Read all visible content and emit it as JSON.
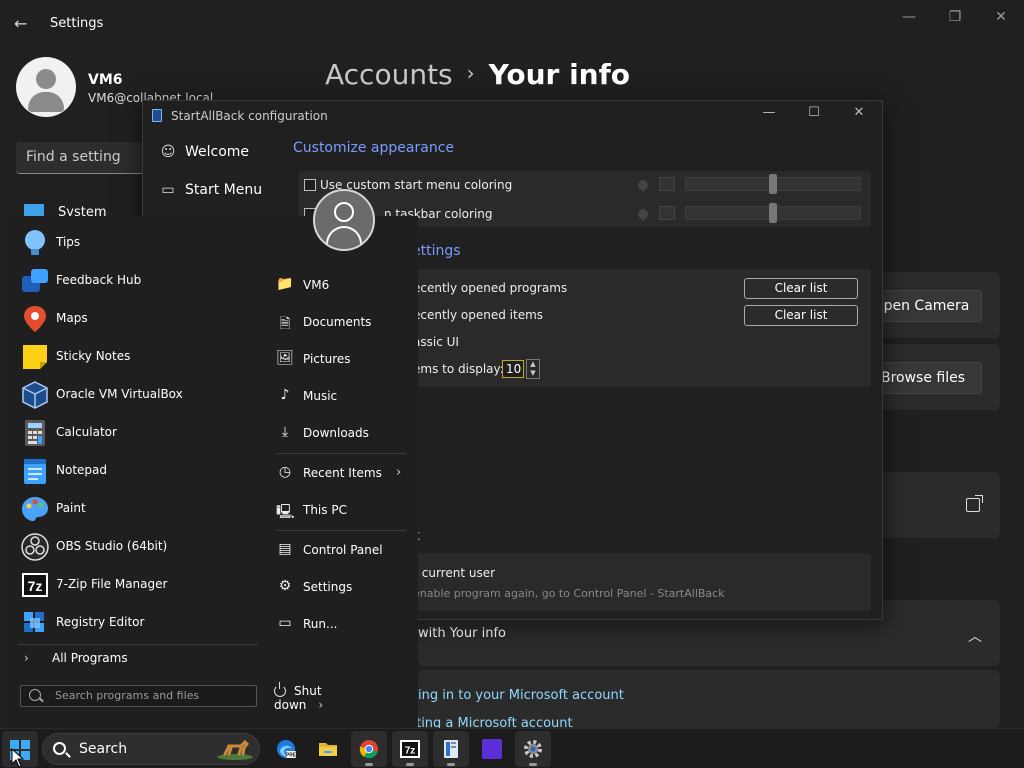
{
  "settings": {
    "title": "Settings",
    "back_icon": "←",
    "user": {
      "name": "VM6",
      "email": "VM6@collabnet.local"
    },
    "find_placeholder": "Find a setting",
    "nav_system": "System",
    "breadcrumb": {
      "parent": "Accounts",
      "separator": "›",
      "current": "Your info"
    },
    "open_camera": "Open Camera",
    "browse_files": "Browse files",
    "related_header": "with Your info",
    "link1": "ing in to your Microsoft account",
    "link2": "Creating a Microsoft account",
    "window_controls": {
      "minimize": "—",
      "maximize": "❐",
      "close": "✕"
    }
  },
  "sab": {
    "title": "StartAllBack configuration",
    "window_controls": {
      "minimize": "—",
      "maximize": "☐",
      "close": "✕"
    },
    "nav": [
      {
        "label": "Welcome",
        "icon": "☺"
      },
      {
        "label": "Start Menu",
        "icon": "▭"
      }
    ],
    "customize_heading": "Customize appearance",
    "opt_start_coloring": "Use custom start menu coloring",
    "opt_taskbar_coloring": "n taskbar coloring",
    "settings_heading": "ettings",
    "recent_programs": "ecently opened programs",
    "recent_items": "ecently opened items",
    "clear_list_1": "Clear list",
    "clear_list_2": "Clear list",
    "classic_ui": "assic UI",
    "items_to_display": "ems to display:",
    "items_value": "10",
    "section3_heading": "k",
    "current_user": "r current user",
    "current_user_sub": "enable program again, go to Control Panel - StartAllBack"
  },
  "startmenu": {
    "apps": [
      {
        "label": "Tips",
        "icon": "tips-icon"
      },
      {
        "label": "Feedback Hub",
        "icon": "feedback-hub-icon"
      },
      {
        "label": "Maps",
        "icon": "maps-icon"
      },
      {
        "label": "Sticky Notes",
        "icon": "sticky-notes-icon"
      },
      {
        "label": "Oracle VM VirtualBox",
        "icon": "virtualbox-icon"
      },
      {
        "label": "Calculator",
        "icon": "calculator-icon"
      },
      {
        "label": "Notepad",
        "icon": "notepad-icon"
      },
      {
        "label": "Paint",
        "icon": "paint-icon"
      },
      {
        "label": "OBS Studio (64bit)",
        "icon": "obs-icon"
      },
      {
        "label": "7-Zip File Manager",
        "icon": "7zip-icon"
      },
      {
        "label": "Registry Editor",
        "icon": "registry-editor-icon"
      }
    ],
    "all_programs": "All Programs",
    "search_placeholder": "Search programs and files",
    "places": [
      {
        "label": "VM6",
        "icon": "📁"
      },
      {
        "label": "Documents",
        "icon": "🗎"
      },
      {
        "label": "Pictures",
        "icon": "🖼"
      },
      {
        "label": "Music",
        "icon": "♪"
      },
      {
        "label": "Downloads",
        "icon": "⤓"
      },
      {
        "label": "Recent Items",
        "icon": "◷"
      },
      {
        "label": "This PC",
        "icon": "🖳"
      },
      {
        "label": "Control Panel",
        "icon": "▤"
      },
      {
        "label": "Settings",
        "icon": "⚙"
      },
      {
        "label": "Run...",
        "icon": "▭"
      }
    ],
    "shutdown": "Shut down"
  },
  "taskbar": {
    "search_label": "Search",
    "apps": [
      {
        "name": "edge-beta-icon"
      },
      {
        "name": "file-explorer-icon"
      },
      {
        "name": "chrome-icon"
      },
      {
        "name": "7zip-icon"
      },
      {
        "name": "startallback-icon"
      },
      {
        "name": "app-purple-icon"
      },
      {
        "name": "settings-gear-icon"
      }
    ]
  }
}
